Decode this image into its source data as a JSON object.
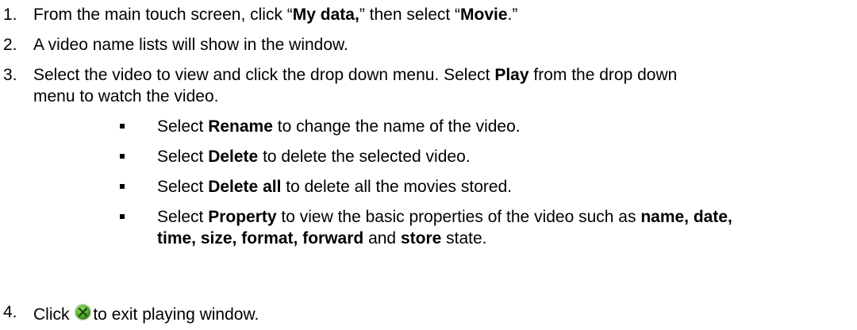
{
  "steps": [
    {
      "number": "1.",
      "segments": [
        "From the main touch screen, click “",
        "My data,",
        "” then select “",
        "Movie",
        ".”"
      ]
    },
    {
      "number": "2.",
      "text": "A video name lists will show in the window."
    },
    {
      "number": "3.",
      "line1_segments": [
        "Select the video to view and click the drop down menu. Select ",
        "Play",
        " from the drop down"
      ],
      "line2": "menu to watch the video.",
      "bullets": [
        {
          "segments": [
            "Select ",
            "Rename",
            " to change the name of the video."
          ]
        },
        {
          "segments": [
            "Select ",
            "Delete",
            " to delete the selected video."
          ]
        },
        {
          "segments": [
            "Select ",
            "Delete all",
            " to delete all the movies stored."
          ]
        },
        {
          "line1_segments": [
            "Select ",
            "Property",
            " to view the basic properties of the video such as ",
            "name, date,"
          ],
          "line2_segments": [
            "time, size, format, forward",
            " and ",
            "store",
            " state."
          ]
        }
      ]
    },
    {
      "number": "4.",
      "before_icon": "Click ",
      "icon": "close-x-circle-icon",
      "after_icon": "to exit playing window."
    }
  ],
  "colors": {
    "text": "#000000",
    "icon_fill": "#5bb531",
    "icon_ring": "#c9d8c2",
    "icon_x": "#1d4d0f"
  }
}
